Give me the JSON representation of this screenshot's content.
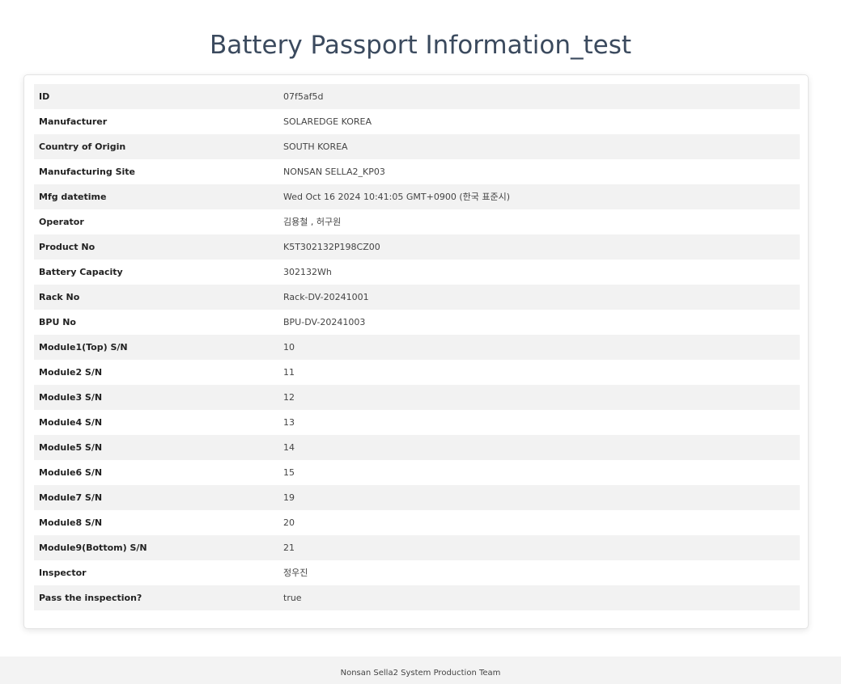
{
  "page": {
    "title": "Battery Passport Information_test"
  },
  "rows": [
    {
      "label": "ID",
      "value": "07f5af5d"
    },
    {
      "label": "Manufacturer",
      "value": "SOLAREDGE KOREA"
    },
    {
      "label": "Country of Origin",
      "value": "SOUTH KOREA"
    },
    {
      "label": "Manufacturing Site",
      "value": "NONSAN SELLA2_KP03"
    },
    {
      "label": "Mfg datetime",
      "value": "Wed Oct 16 2024 10:41:05 GMT+0900 (한국 표준시)"
    },
    {
      "label": "Operator",
      "value": "김용철 , 허구원"
    },
    {
      "label": "Product No",
      "value": "K5T302132P198CZ00"
    },
    {
      "label": "Battery Capacity",
      "value": "302132Wh"
    },
    {
      "label": "Rack No",
      "value": "Rack-DV-20241001"
    },
    {
      "label": "BPU No",
      "value": "BPU-DV-20241003"
    },
    {
      "label": "Module1(Top) S/N",
      "value": "10"
    },
    {
      "label": "Module2 S/N",
      "value": "11"
    },
    {
      "label": "Module3 S/N",
      "value": "12"
    },
    {
      "label": "Module4 S/N",
      "value": "13"
    },
    {
      "label": "Module5 S/N",
      "value": "14"
    },
    {
      "label": "Module6 S/N",
      "value": "15"
    },
    {
      "label": "Module7 S/N",
      "value": "19"
    },
    {
      "label": "Module8 S/N",
      "value": "20"
    },
    {
      "label": "Module9(Bottom) S/N",
      "value": "21"
    },
    {
      "label": "Inspector",
      "value": "정우진"
    },
    {
      "label": "Pass the inspection?",
      "value": "true"
    }
  ],
  "footer": {
    "text": "Nonsan Sella2 System Production Team"
  }
}
